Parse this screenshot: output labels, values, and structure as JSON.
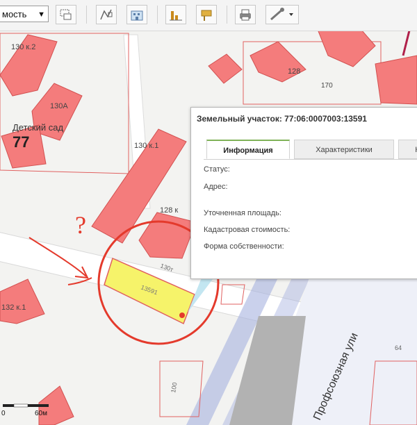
{
  "toolbar": {
    "layer_select_value": "мость",
    "buttons": [
      "layers-icon",
      "measure-icon",
      "building-info-icon",
      "chart-icon",
      "sign-icon",
      "print-icon",
      "ruler-icon"
    ]
  },
  "map": {
    "labels": {
      "b130k2": "130 к.2",
      "b130a": "130А",
      "kindergarten": "Детский сад",
      "sign77": "77",
      "b130k1": "130 к.1",
      "b128a": "128",
      "b170": "170",
      "b128k": "128 к",
      "b130t": "130т",
      "parcel_id": "13591",
      "b132k1": "132 к.1",
      "b100": "100",
      "b64": "64",
      "street": "Профсоюзная ули"
    },
    "scale": {
      "zero": "0",
      "end": "60м"
    },
    "annotation_question": "?"
  },
  "popup": {
    "title": "Земельный участок: 77:06:0007003:13591",
    "tabs": [
      "Информация",
      "Характеристики",
      "Кт"
    ],
    "active_tab": 0,
    "fields": [
      {
        "label": "Статус:",
        "value": ""
      },
      {
        "label": "Адрес:",
        "value": ""
      },
      {
        "label": "Уточненная площадь:",
        "value": ""
      },
      {
        "label": "Кадастровая стоимость:",
        "value": ""
      },
      {
        "label": "Форма собственности:",
        "value": ""
      }
    ]
  },
  "colors": {
    "building_fill": "#f47c7c",
    "parcel_outline": "#e06060",
    "highlight_parcel": "#f6f36a",
    "road": "#ffffff",
    "ink_red": "#e43a2c",
    "street_blue": "#9aa6d8",
    "tab_accent": "#7fb257"
  }
}
